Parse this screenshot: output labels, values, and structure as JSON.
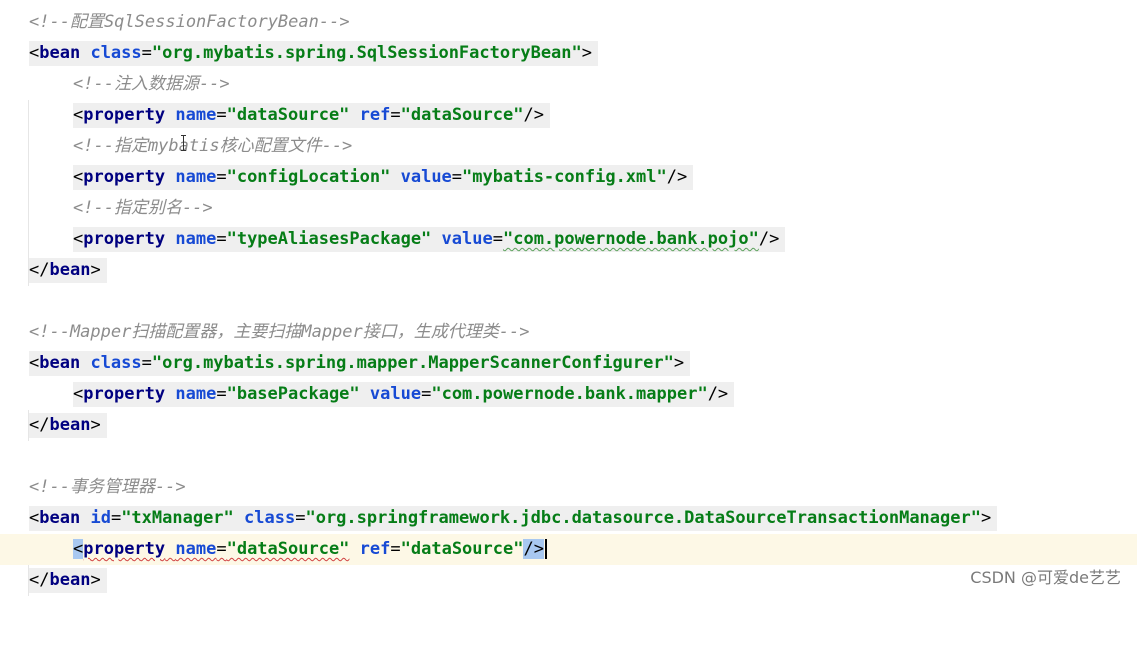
{
  "editor": {
    "lines": [
      {
        "comment": "<!--配置SqlSessionFactoryBean-->"
      },
      {
        "open": "<",
        "tag": "bean",
        "attrs": [
          {
            "name": "class",
            "value": "\"org.mybatis.spring.SqlSessionFactoryBean\""
          }
        ],
        "close": ">"
      },
      {
        "comment": "<!--注入数据源-->"
      },
      {
        "open": "<",
        "tag": "property",
        "attrs": [
          {
            "name": "name",
            "value": "\"dataSource\""
          },
          {
            "name": "ref",
            "value": "\"dataSource\""
          }
        ],
        "close": "/>"
      },
      {
        "comment": "<!--指定mybatis核心配置文件-->"
      },
      {
        "open": "<",
        "tag": "property",
        "attrs": [
          {
            "name": "name",
            "value": "\"configLocation\""
          },
          {
            "name": "value",
            "value": "\"mybatis-config.xml\""
          }
        ],
        "close": "/>"
      },
      {
        "comment": "<!--指定别名-->"
      },
      {
        "open": "<",
        "tag": "property",
        "attrs": [
          {
            "name": "name",
            "value": "\"typeAliasesPackage\""
          },
          {
            "name": "value",
            "value": "\"com.powernode.bank.pojo\""
          }
        ],
        "close": "/>"
      },
      {
        "open": "</",
        "tag": "bean",
        "close": ">"
      },
      {
        "comment": "<!--Mapper扫描配置器，主要扫描Mapper接口，生成代理类-->"
      },
      {
        "open": "<",
        "tag": "bean",
        "attrs": [
          {
            "name": "class",
            "value": "\"org.mybatis.spring.mapper.MapperScannerConfigurer\""
          }
        ],
        "close": ">"
      },
      {
        "open": "<",
        "tag": "property",
        "attrs": [
          {
            "name": "name",
            "value": "\"basePackage\""
          },
          {
            "name": "value",
            "value": "\"com.powernode.bank.mapper\""
          }
        ],
        "close": "/>"
      },
      {
        "open": "</",
        "tag": "bean",
        "close": ">"
      },
      {
        "comment": "<!--事务管理器-->"
      },
      {
        "open": "<",
        "tag": "bean",
        "attrs": [
          {
            "name": "id",
            "value": "\"txManager\""
          },
          {
            "name": "class",
            "value": "\"org.springframework.jdbc.datasource.DataSourceTransactionManager\""
          }
        ],
        "close": ">"
      },
      {
        "open": "<",
        "tag": "property",
        "attrs": [
          {
            "name": "name",
            "value": "\"dataSource\""
          },
          {
            "name": "ref",
            "value": "\"dataSource\""
          }
        ],
        "close": "/>"
      },
      {
        "open": "</",
        "tag": "bean",
        "close": ">"
      }
    ]
  },
  "watermark": "CSDN @可爱de艺艺",
  "colors": {
    "comment": "#8c8c8c",
    "tag": "#000080",
    "attribute": "#174ad4",
    "value": "#067d17",
    "current_line": "#fdf8e6",
    "bracket_match": "#a8c8f0"
  }
}
